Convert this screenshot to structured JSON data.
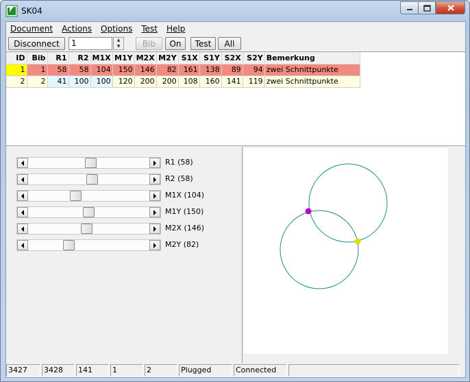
{
  "window": {
    "title": "SK04"
  },
  "menu": [
    "Document",
    "Actions",
    "Options",
    "Test",
    "Help"
  ],
  "toolbar": {
    "disconnect": "Disconnect",
    "spin_value": "1",
    "bib": "Bib",
    "on": "On",
    "test": "Test",
    "all": "All"
  },
  "grid": {
    "headers": [
      "ID",
      "Bib",
      "R1",
      "R2",
      "M1X",
      "M1Y",
      "M2X",
      "M2Y",
      "S1X",
      "S1Y",
      "S2X",
      "S2Y",
      "Bemerkung"
    ],
    "rows": [
      [
        "1",
        "1",
        "58",
        "58",
        "104",
        "150",
        "146",
        "82",
        "161",
        "138",
        "89",
        "94",
        "zwei Schnittpunkte"
      ],
      [
        "2",
        "2",
        "41",
        "100",
        "100",
        "120",
        "200",
        "200",
        "108",
        "160",
        "141",
        "119",
        "zwei Schnittpunkte"
      ]
    ]
  },
  "sliders": [
    {
      "label": "R1 (58)",
      "level": 0.52
    },
    {
      "label": "R2 (58)",
      "level": 0.53
    },
    {
      "label": "M1X (104)",
      "level": 0.38
    },
    {
      "label": "M1Y (150)",
      "level": 0.5
    },
    {
      "label": "M2X (146)",
      "level": 0.48
    },
    {
      "label": "M2Y (82)",
      "level": 0.32
    }
  ],
  "status": [
    "3427",
    "3428",
    "141",
    "1",
    "2",
    "Plugged",
    "Connected",
    ""
  ],
  "colors": {
    "circle": "#1c8c8c",
    "point1": "#c000c0",
    "point2": "#e0e000",
    "row1": "#f28a80",
    "row2": "#fffee0",
    "id_selected": "#ffff00"
  }
}
